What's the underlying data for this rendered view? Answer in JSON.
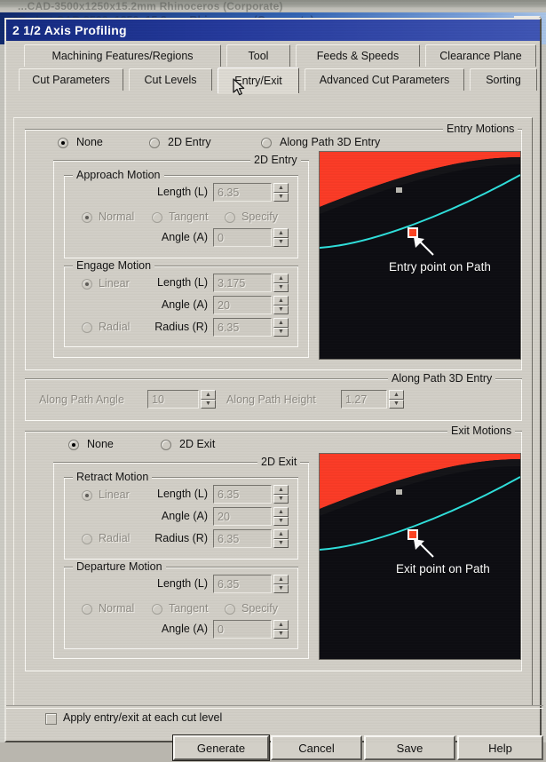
{
  "background_window": {
    "obscured_title": "...CAD-3500x1250x15.2mm  Rhinoceros  (Corporate)",
    "blurred_caption": "3D abot  CAD 3500x1250x15.2mm  Rhinoceros (Corporate)",
    "close_label": "✕"
  },
  "dialog": {
    "title": "2 1/2 Axis Profiling"
  },
  "tabs": [
    {
      "label": "Machining Features/Regions",
      "selected": false
    },
    {
      "label": "Tool",
      "selected": false
    },
    {
      "label": "Feeds & Speeds",
      "selected": false
    },
    {
      "label": "Clearance Plane",
      "selected": false
    },
    {
      "label": "Cut Parameters",
      "selected": false
    },
    {
      "label": "Cut Levels",
      "selected": false
    },
    {
      "label": "Entry/Exit",
      "selected": true
    },
    {
      "label": "Advanced Cut Parameters",
      "selected": false
    },
    {
      "label": "Sorting",
      "selected": false
    }
  ],
  "entry_motions": {
    "group_label": "Entry Motions",
    "mode_options": [
      {
        "label": "None",
        "selected": true
      },
      {
        "label": "2D Entry",
        "selected": false
      },
      {
        "label": "Along Path 3D Entry",
        "selected": false
      }
    ],
    "two_d_entry": {
      "group_label": "2D Entry",
      "approach": {
        "group_label": "Approach Motion",
        "length_label": "Length (L)",
        "length_value": "6.35",
        "angle_label": "Angle (A)",
        "angle_value": "0",
        "type_options": [
          {
            "label": "Normal",
            "selected": true
          },
          {
            "label": "Tangent",
            "selected": false
          },
          {
            "label": "Specify",
            "selected": false
          }
        ]
      },
      "engage": {
        "group_label": "Engage Motion",
        "linear_label": "Linear",
        "radial_label": "Radial",
        "length_label": "Length (L)",
        "length_value": "3.175",
        "angle_label": "Angle (A)",
        "angle_value": "20",
        "radius_label": "Radius (R)",
        "radius_value": "6.35"
      }
    },
    "along_path": {
      "group_label": "Along Path 3D Entry",
      "angle_label": "Along Path Angle",
      "angle_value": "10",
      "height_label": "Along Path Height",
      "height_value": "1.27"
    },
    "preview": {
      "caption": "Entry point on Path"
    }
  },
  "exit_motions": {
    "group_label": "Exit Motions",
    "mode_options": [
      {
        "label": "None",
        "selected": true
      },
      {
        "label": "2D Exit",
        "selected": false
      }
    ],
    "two_d_exit": {
      "group_label": "2D Exit",
      "retract": {
        "group_label": "Retract Motion",
        "linear_label": "Linear",
        "radial_label": "Radial",
        "length_label": "Length (L)",
        "length_value": "6.35",
        "angle_label": "Angle (A)",
        "angle_value": "20",
        "radius_label": "Radius (R)",
        "radius_value": "6.35"
      },
      "departure": {
        "group_label": "Departure Motion",
        "length_label": "Length (L)",
        "length_value": "6.35",
        "angle_label": "Angle (A)",
        "angle_value": "0",
        "type_options": [
          {
            "label": "Normal",
            "selected": false
          },
          {
            "label": "Tangent",
            "selected": false
          },
          {
            "label": "Specify",
            "selected": false
          }
        ]
      }
    },
    "preview": {
      "caption": "Exit point on Path"
    }
  },
  "apply_option": {
    "label": "Apply entry/exit at each cut level",
    "checked": false
  },
  "buttons": [
    {
      "label": "Generate",
      "default": true
    },
    {
      "label": "Cancel",
      "default": false
    },
    {
      "label": "Save",
      "default": false
    },
    {
      "label": "Help",
      "default": false
    }
  ],
  "spinner": {
    "up": "▲",
    "down": "▼"
  },
  "colors": {
    "dialog_face": "#d2cfc7",
    "titlebar": "#1d2f8c",
    "preview_background": "#0d0d12",
    "preview_stock": "#fb3b26",
    "preview_toolpath": "#2fe0dc",
    "preview_marker": "#ff4422"
  }
}
